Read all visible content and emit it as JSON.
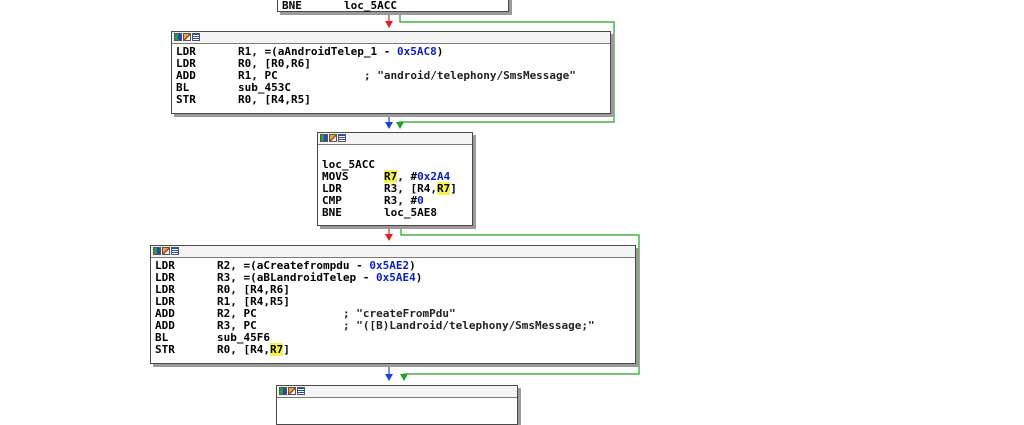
{
  "colors": {
    "edge_true": "#e02020",
    "edge_false": "#22a026",
    "edge_unconditional": "#1c3fe0",
    "highlight": "#f7f44a",
    "number": "#0b1fbf"
  },
  "blocks": [
    {
      "id": "block-top",
      "lines": [
        {
          "mnem": "BNE",
          "op": "loc_5ACC"
        }
      ]
    },
    {
      "id": "block-sms-class",
      "lines": [
        {
          "mnem": "LDR",
          "op": [
            {
              "t": "R1, =(aAndroidTelep_1 - "
            },
            {
              "t": "0x5AC8",
              "c": "num"
            },
            {
              "t": ")"
            }
          ]
        },
        {
          "mnem": "LDR",
          "op": "R0, [R0,R6]"
        },
        {
          "mnem": "ADD",
          "op": "R1, PC",
          "cmt": "; \"android/telephony/SmsMessage\""
        },
        {
          "mnem": "BL",
          "op": "sub_453C"
        },
        {
          "mnem": "STR",
          "op": "R0, [R4,R5]"
        }
      ]
    },
    {
      "id": "block-loc-5acc",
      "label": "loc_5ACC",
      "lines": [
        {
          "mnem": "MOVS",
          "op": [
            {
              "t": "R7",
              "c": "hl"
            },
            {
              "t": ", #"
            },
            {
              "t": "0x2A4",
              "c": "num"
            }
          ]
        },
        {
          "mnem": "LDR",
          "op": [
            {
              "t": "R3, [R4,"
            },
            {
              "t": "R7",
              "c": "hl"
            },
            {
              "t": "]"
            }
          ]
        },
        {
          "mnem": "CMP",
          "op": [
            {
              "t": "R3, #"
            },
            {
              "t": "0",
              "c": "num"
            }
          ]
        },
        {
          "mnem": "BNE",
          "op": "loc_5AE8"
        }
      ]
    },
    {
      "id": "block-create-from-pdu",
      "lines": [
        {
          "mnem": "LDR",
          "op": [
            {
              "t": "R2, =(aCreatefrompdu - "
            },
            {
              "t": "0x5AE2",
              "c": "num"
            },
            {
              "t": ")"
            }
          ]
        },
        {
          "mnem": "LDR",
          "op": [
            {
              "t": "R3, =(aBLandroidTelep - "
            },
            {
              "t": "0x5AE4",
              "c": "num"
            },
            {
              "t": ")"
            }
          ]
        },
        {
          "mnem": "LDR",
          "op": "R0, [R4,R6]"
        },
        {
          "mnem": "LDR",
          "op": "R1, [R4,R5]"
        },
        {
          "mnem": "ADD",
          "op": "R2, PC",
          "cmt": "; \"createFromPdu\""
        },
        {
          "mnem": "ADD",
          "op": "R3, PC",
          "cmt": "; \"([B)Landroid/telephony/SmsMessage;\""
        },
        {
          "mnem": "BL",
          "op": "sub_45F6"
        },
        {
          "mnem": "STR",
          "op": [
            {
              "t": "R0, [R4,"
            },
            {
              "t": "R7",
              "c": "hl"
            },
            {
              "t": "]"
            }
          ]
        }
      ]
    },
    {
      "id": "block-bottom",
      "lines": []
    }
  ]
}
